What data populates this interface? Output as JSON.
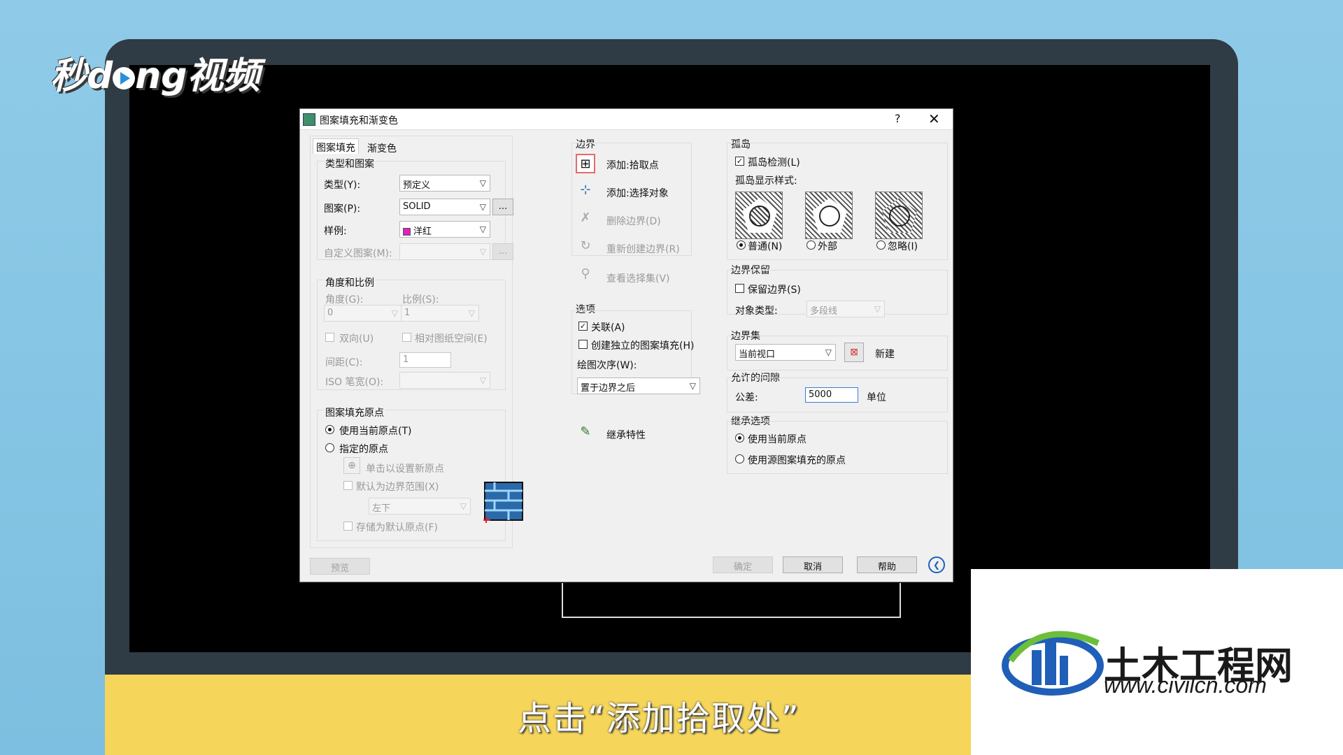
{
  "overlay": {
    "logo": "秒d   ng视频",
    "caption": "点击“添加拾取处”",
    "brand_cn": "土木工程网",
    "brand_url": "www.civilcn.com"
  },
  "dialog": {
    "title": "图案填充和渐变色",
    "help_char": "?",
    "close_char": "✕",
    "tabs": [
      "图案填充",
      "渐变色"
    ],
    "type_pattern": {
      "group": "类型和图案",
      "type_label": "类型(Y):",
      "type_value": "预定义",
      "pattern_label": "图案(P):",
      "pattern_value": "SOLID",
      "swatch_label": "样例:",
      "swatch_value": "洋红",
      "swatch_color": "#e020c0",
      "custom_label": "自定义图案(M):",
      "browse": "..."
    },
    "angle_scale": {
      "group": "角度和比例",
      "angle_label": "角度(G):",
      "angle_value": "0",
      "scale_label": "比例(S):",
      "scale_value": "1",
      "double_label": "双向(U)",
      "relative_label": "相对图纸空间(E)",
      "spacing_label": "间距(C):",
      "spacing_value": "1",
      "iso_label": "ISO 笔宽(O):"
    },
    "origin": {
      "group": "图案填充原点",
      "use_current": "使用当前原点(T)",
      "specified": "指定的原点",
      "click_set": "单击以设置新原点",
      "default_extent": "默认为边界范围(X)",
      "extent_value": "左下",
      "store_default": "存储为默认原点(F)"
    },
    "boundaries": {
      "group": "边界",
      "add_pick": "添加:拾取点",
      "add_select": "添加:选择对象",
      "remove": "删除边界(D)",
      "recreate": "重新创建边界(R)",
      "view_sel": "查看选择集(V)"
    },
    "options": {
      "group": "选项",
      "associative": "关联(A)",
      "separate": "创建独立的图案填充(H)",
      "draw_order_label": "绘图次序(W):",
      "draw_order_value": "置于边界之后",
      "inherit": "继承特性"
    },
    "islands": {
      "group": "孤岛",
      "detect": "孤岛检测(L)",
      "style_label": "孤岛显示样式:",
      "normal": "普通(N)",
      "outer": "外部",
      "ignore": "忽略(I)"
    },
    "retain": {
      "group": "边界保留",
      "keep": "保留边界(S)",
      "obj_type_label": "对象类型:",
      "obj_type_value": "多段线"
    },
    "boundary_set": {
      "group": "边界集",
      "value": "当前视口",
      "new_label": "新建"
    },
    "gap": {
      "group": "允许的间隙",
      "tol_label": "公差:",
      "tol_value": "5000",
      "unit": "单位"
    },
    "inherit_opts": {
      "group": "继承选项",
      "use_current": "使用当前原点",
      "use_source": "使用源图案填充的原点"
    },
    "footer": {
      "preview": "预览",
      "ok": "确定",
      "cancel": "取消",
      "help": "帮助",
      "more": "❮"
    }
  }
}
